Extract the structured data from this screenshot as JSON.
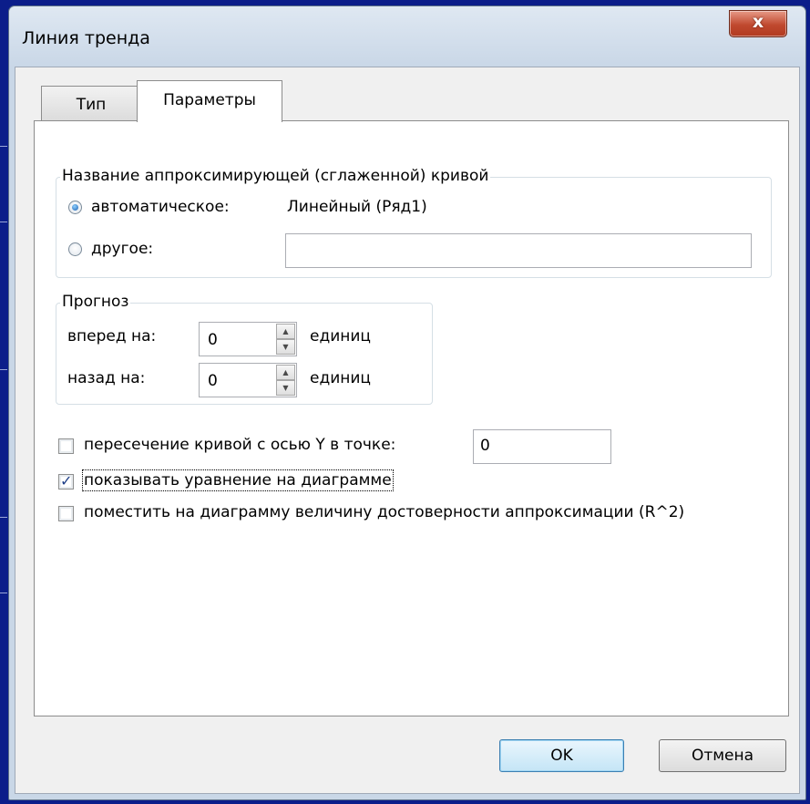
{
  "window": {
    "title": "Линия тренда",
    "close_symbol": "x"
  },
  "tabs": [
    {
      "label": "Тип"
    },
    {
      "label": "Параметры"
    }
  ],
  "name_group": {
    "legend": "Название аппроксимирующей (сглаженной) кривой",
    "auto_label": "автоматическое:",
    "auto_value": "Линейный (Ряд1)",
    "auto_selected": true,
    "other_label": "другое:",
    "other_value": ""
  },
  "forecast_group": {
    "legend": "Прогноз",
    "forward_label": "вперед на:",
    "forward_value": "0",
    "forward_units": "единиц",
    "backward_label": "назад на:",
    "backward_value": "0",
    "backward_units": "единиц"
  },
  "options": {
    "intercept_label": "пересечение кривой с осью Y в точке:",
    "intercept_checked": false,
    "intercept_value": "0",
    "equation_label": "показывать уравнение на диаграмме",
    "equation_checked": true,
    "r2_label": "поместить на диаграмму величину достоверности аппроксимации (R^2)",
    "r2_checked": false
  },
  "buttons": {
    "ok": "OK",
    "cancel": "Отмена"
  }
}
